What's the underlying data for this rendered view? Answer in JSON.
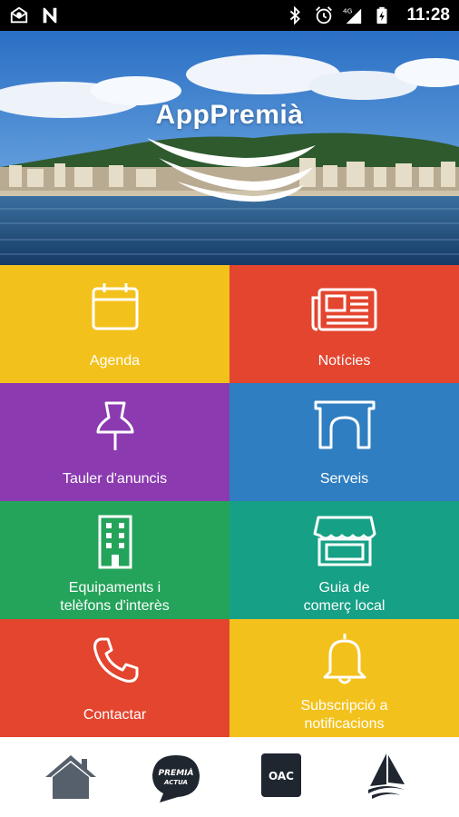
{
  "status_bar": {
    "time": "11:28",
    "network_label": "4G"
  },
  "hero": {
    "title": "AppPremià"
  },
  "tiles": [
    {
      "label": "Agenda",
      "icon": "calendar-icon",
      "color": "#f3c11c"
    },
    {
      "label": "Notícies",
      "icon": "newspaper-icon",
      "color": "#e3452f"
    },
    {
      "label": "Tauler d'anuncis",
      "icon": "pushpin-icon",
      "color": "#8b3ab0"
    },
    {
      "label": "Serveis",
      "icon": "arch-icon",
      "color": "#2f7ec1"
    },
    {
      "label_line1": "Equipaments i",
      "label_line2": "telèfons d'interès",
      "icon": "building-icon",
      "color": "#24a35a"
    },
    {
      "label_line1": "Guia de",
      "label_line2": "comerç local",
      "icon": "shop-icon",
      "color": "#16a085"
    },
    {
      "label": "Contactar",
      "icon": "phone-icon",
      "color": "#e3452f"
    },
    {
      "label_line1": "Subscripció a",
      "label_line2": "notificacions",
      "icon": "bell-icon",
      "color": "#f3c11c"
    }
  ],
  "bottom_nav": {
    "items": [
      {
        "icon": "home-icon"
      },
      {
        "icon": "premia-actua-icon",
        "text_line1": "PREMIÀ",
        "text_line2": "ACTUA"
      },
      {
        "icon": "oac-icon",
        "text": "OAC"
      },
      {
        "icon": "sail-logo-icon"
      }
    ]
  }
}
